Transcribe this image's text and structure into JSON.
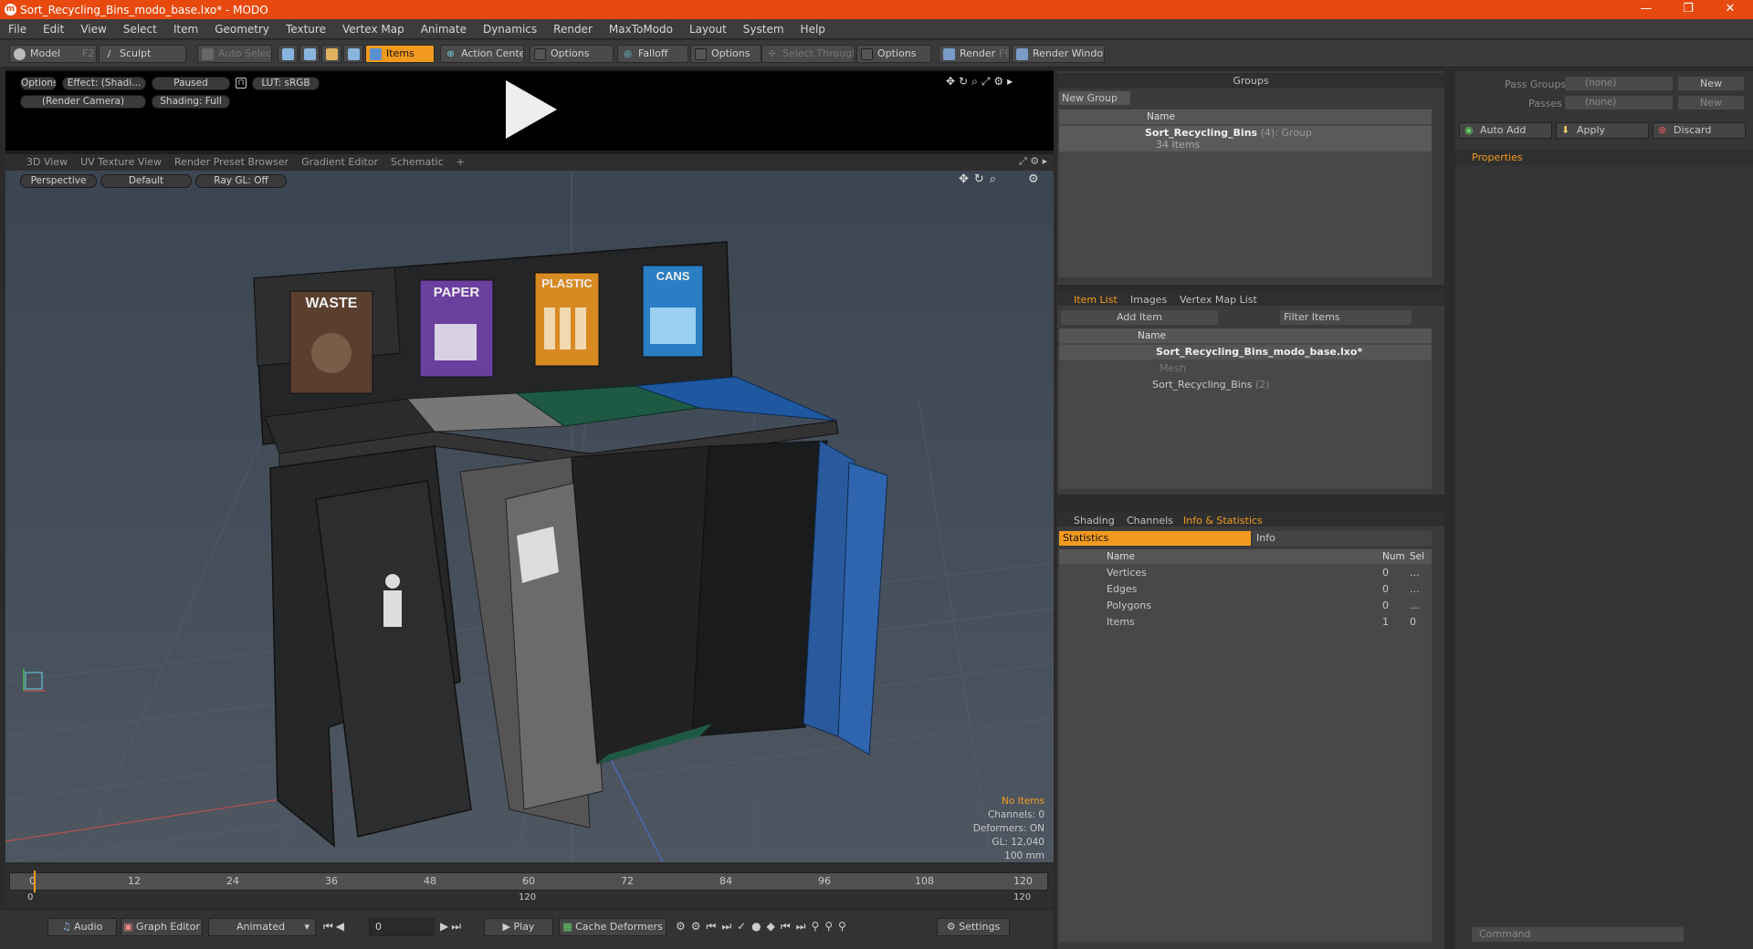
{
  "window": {
    "title": "Sort_Recycling_Bins_modo_base.lxo* - MODO",
    "logo": "m",
    "minimize": "—",
    "maximize": "❐",
    "close": "✕"
  },
  "menu": [
    "File",
    "Edit",
    "View",
    "Select",
    "Item",
    "Geometry",
    "Texture",
    "Vertex Map",
    "Animate",
    "Dynamics",
    "Render",
    "MaxToModo",
    "Layout",
    "System",
    "Help"
  ],
  "toolbar": {
    "model": "Model",
    "model_key": "F2",
    "sculpt": "Sculpt",
    "auto_select": "Auto Select",
    "items": "Items",
    "action_center": "Action Center",
    "options1": "Options",
    "falloff": "Falloff",
    "options2": "Options",
    "select_through": "Select Through",
    "options3": "Options",
    "render": "Render",
    "render_key": "F9",
    "render_window": "Render Window"
  },
  "preview": {
    "options": "Options",
    "effect": "Effect: (Shadi...",
    "paused": "Paused",
    "lut": "LUT: sRGB",
    "camera": "(Render Camera)",
    "shading": "Shading: Full"
  },
  "viewport_tabs": [
    "3D View",
    "UV Texture View",
    "Render Preset Browser",
    "Gradient Editor",
    "Schematic"
  ],
  "viewport_add": "+",
  "viewport": {
    "perspective": "Perspective",
    "default": "Default",
    "raygl": "Ray GL: Off",
    "bin_labels": [
      "WASTE",
      "PAPER",
      "PLASTIC",
      "CANS"
    ],
    "stats": [
      "No Items",
      "Channels: 0",
      "Deformers: ON",
      "GL: 12,040",
      "100 mm"
    ]
  },
  "timeline": {
    "ticks": [
      "0",
      "12",
      "24",
      "36",
      "48",
      "60",
      "72",
      "84",
      "96",
      "108",
      "120"
    ],
    "lower_left": "0",
    "lower_mid": "120",
    "lower_right": "120"
  },
  "bottombar": {
    "audio": "Audio",
    "graph_editor": "Graph Editor",
    "animated": "Animated",
    "frame": "0",
    "play": "Play",
    "cache_deformers": "Cache Deformers",
    "settings": "Settings"
  },
  "groups": {
    "title": "Groups",
    "new_group": "New Group",
    "col_name": "Name",
    "item_name": "Sort_Recycling_Bins",
    "item_count": "(4)",
    "item_type": ": Group",
    "item_sub": "34 Items"
  },
  "passes": {
    "pass_groups_label": "Pass Groups",
    "pass_groups_value": "(none)",
    "new": "New",
    "passes_label": "Passes",
    "passes_value": "(none)",
    "new2": "New",
    "auto_add": "Auto Add",
    "apply": "Apply",
    "discard": "Discard",
    "properties_tab": "Properties"
  },
  "itemlist": {
    "tabs": [
      "Item List",
      "Images",
      "Vertex Map List"
    ],
    "add_item": "Add Item",
    "filter_items": "Filter Items",
    "col_name": "Name",
    "rows": [
      "Sort_Recycling_Bins_modo_base.lxo*",
      "Mesh",
      "Sort_Recycling_Bins"
    ],
    "row_count": "(2)"
  },
  "stats": {
    "tabs": [
      "Shading",
      "Channels",
      "Info & Statistics"
    ],
    "sub_tabs": [
      "Statistics",
      "Info"
    ],
    "col_name": "Name",
    "col_num": "Num",
    "col_sel": "Sel",
    "rows": [
      {
        "name": "Vertices",
        "num": "0",
        "sel": "..."
      },
      {
        "name": "Edges",
        "num": "0",
        "sel": "..."
      },
      {
        "name": "Polygons",
        "num": "0",
        "sel": "..."
      },
      {
        "name": "Items",
        "num": "1",
        "sel": "0"
      }
    ]
  },
  "command": {
    "placeholder": "Command"
  },
  "colors": {
    "accent": "#f29a1e",
    "titlebar": "#e8490f"
  }
}
